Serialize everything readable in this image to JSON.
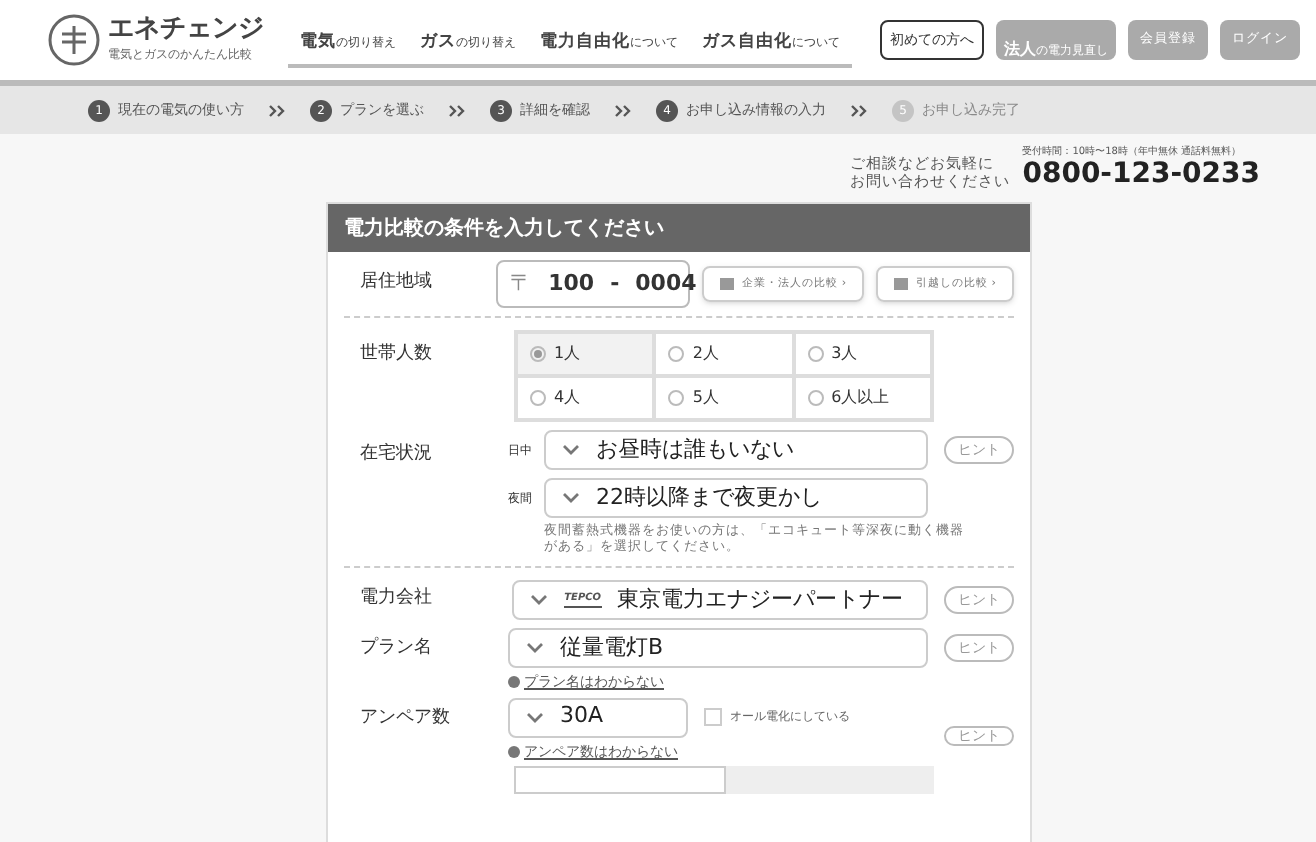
{
  "logo": {
    "name": "エネチェンジ",
    "tagline": "電気とガスのかんたん比較"
  },
  "nav": [
    {
      "main": "電気",
      "sub": "の切り替え"
    },
    {
      "main": "ガス",
      "sub": "の切り替え"
    },
    {
      "main": "電力自由化",
      "sub": "について"
    },
    {
      "main": "ガス自由化",
      "sub": "について"
    }
  ],
  "header_buttons": [
    {
      "kind": "outline",
      "label": "初めての方へ"
    },
    {
      "kind": "corporate",
      "main": "法人",
      "sub": "の電力見直し"
    },
    {
      "kind": "plain",
      "label": "会員登録"
    },
    {
      "kind": "plain",
      "label": "ログイン"
    }
  ],
  "steps": [
    {
      "number": "1",
      "label": "現在の電気の使い方",
      "disabled": false
    },
    {
      "number": "2",
      "label": "プランを選ぶ",
      "disabled": false
    },
    {
      "number": "3",
      "label": "詳細を確認",
      "disabled": false
    },
    {
      "number": "4",
      "label": "お申し込み情報の入力",
      "disabled": false
    },
    {
      "number": "5",
      "label": "お申し込み完了",
      "disabled": true
    }
  ],
  "contact": {
    "lead_1": "ご相談などお気軽に",
    "lead_2": "お問い合わせください",
    "hours": "受付時間：10時〜18時（年中無休 通話料無料）",
    "phone": "0800-123-0233"
  },
  "form": {
    "title": "電力比較の条件を入力してください",
    "area": {
      "label": "居住地域",
      "postal_mark": "〒",
      "postal_1": "100",
      "dash": "-",
      "postal_2": "0004",
      "buttons": [
        "企業・法人の比較 ›",
        "引越しの比較 ›"
      ]
    },
    "household": {
      "label": "世帯人数",
      "options": [
        {
          "label": "1人",
          "selected": true
        },
        {
          "label": "2人",
          "selected": false
        },
        {
          "label": "3人",
          "selected": false
        },
        {
          "label": "4人",
          "selected": false
        },
        {
          "label": "5人",
          "selected": false
        },
        {
          "label": "6人以上",
          "selected": false
        }
      ]
    },
    "presence": {
      "label": "在宅状況",
      "rows": [
        {
          "label": "日中",
          "value": "お昼時は誰もいない",
          "hint": "ヒント"
        },
        {
          "label": "夜間",
          "value": "22時以降まで夜更かし"
        }
      ],
      "note": "夜間蓄熱式機器をお使いの方は、「エコキュート等深夜に動く機器がある」を選択してください。"
    },
    "company": {
      "label": "電力会社",
      "logo": "TEPCO",
      "value": "東京電力エナジーパートナー",
      "hint": "ヒント"
    },
    "plan": {
      "label": "プラン名",
      "value": "従量電灯B",
      "hint": "ヒント",
      "link": "プラン名はわからない"
    },
    "ampere": {
      "label": "アンペア数",
      "value": "30A",
      "checkbox": {
        "label": "オール電化にしている",
        "checked": false
      },
      "hint": "ヒント",
      "link": "アンペア数はわからない"
    }
  }
}
